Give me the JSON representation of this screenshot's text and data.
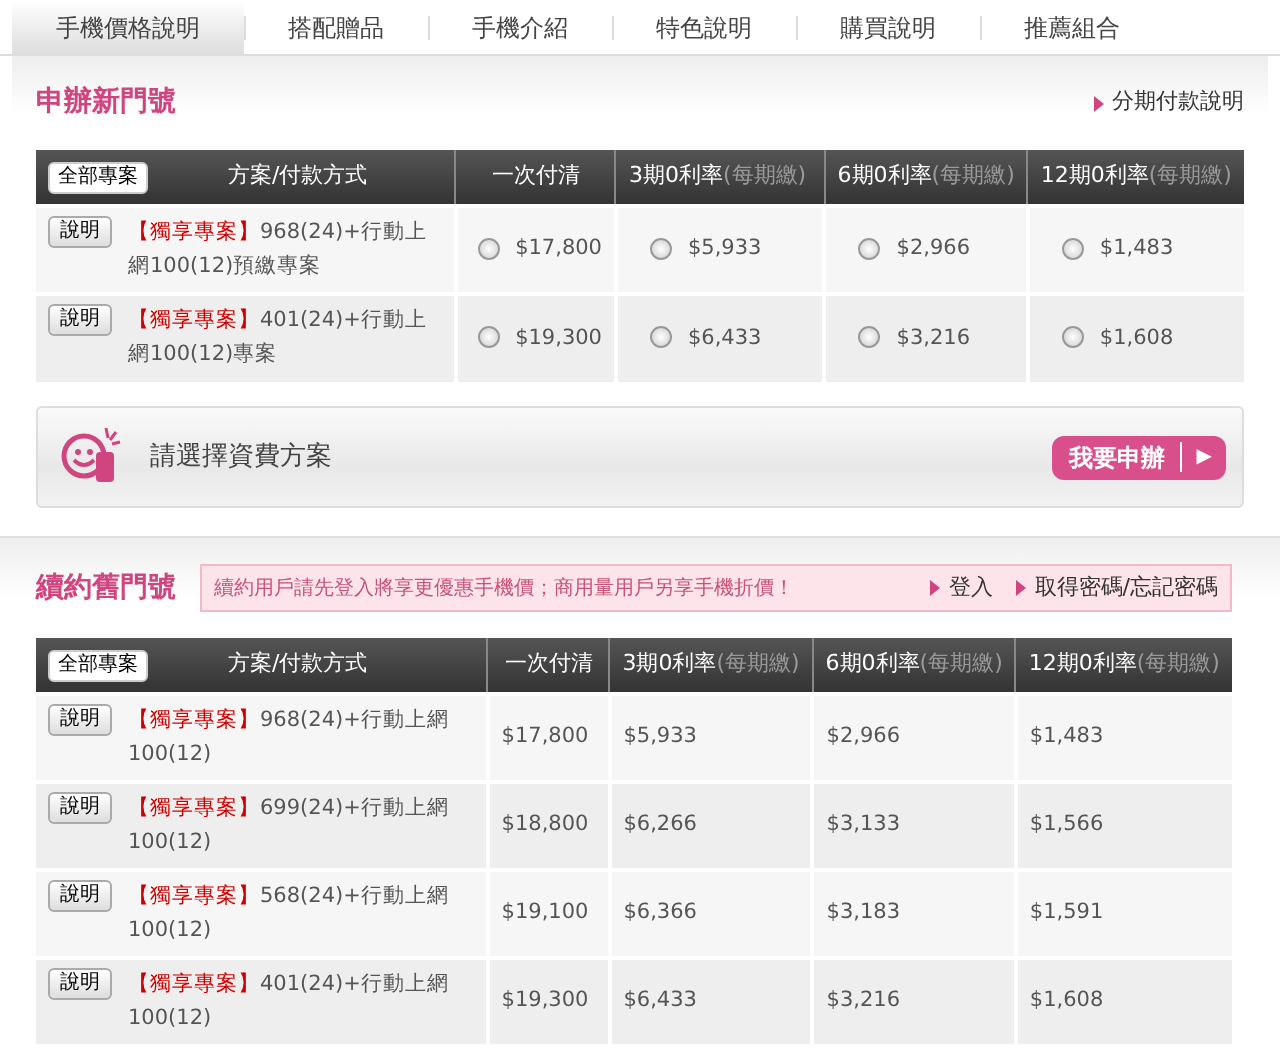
{
  "tabs": [
    {
      "label": "手機價格說明",
      "selected": true
    },
    {
      "label": "搭配贈品",
      "selected": false
    },
    {
      "label": "手機介紹",
      "selected": false
    },
    {
      "label": "特色說明",
      "selected": false
    },
    {
      "label": "購買說明",
      "selected": false
    },
    {
      "label": "推薦組合",
      "selected": false
    }
  ],
  "new_number": {
    "title": "申辦新門號",
    "link": "分期付款說明",
    "table": {
      "filter_button": "全部專案",
      "columns": [
        {
          "label": "方案/付款方式"
        },
        {
          "label": "一次付清"
        },
        {
          "label": "3期0利率",
          "note": "(每期繳)"
        },
        {
          "label": "6期0利率",
          "note": "(每期繳)"
        },
        {
          "label": "12期0利率",
          "note": "(每期繳)"
        }
      ],
      "rows": [
        {
          "info_button": "說明",
          "tag": "【獨享專案】",
          "plan": "968(24)+行動上網100(12)預繳專案",
          "prices": [
            {
              "price": "$17,800",
              "selected": false
            },
            {
              "price": "$5,933",
              "selected": false
            },
            {
              "price": "$2,966",
              "selected": false
            },
            {
              "price": "$1,483",
              "selected": false
            }
          ]
        },
        {
          "info_button": "說明",
          "tag": "【獨享專案】",
          "plan": "401(24)+行動上網100(12)專案",
          "prices": [
            {
              "price": "$19,300",
              "selected": false
            },
            {
              "price": "$6,433",
              "selected": false
            },
            {
              "price": "$3,216",
              "selected": false
            },
            {
              "price": "$1,608",
              "selected": false
            }
          ]
        }
      ]
    },
    "prompt": "請選擇資費方案",
    "apply_button": "我要申辦",
    "apply_arrow": "▶"
  },
  "renewal": {
    "title": "續約舊門號",
    "notice": "續約用戶請先登入將享更優惠手機價；商用量用戶另享手機折價！",
    "links": [
      "登入",
      "取得密碼/忘記密碼"
    ],
    "table": {
      "filter_button": "全部專案",
      "columns": [
        {
          "label": "方案/付款方式"
        },
        {
          "label": "一次付清"
        },
        {
          "label": "3期0利率",
          "note": "(每期繳)"
        },
        {
          "label": "6期0利率",
          "note": "(每期繳)"
        },
        {
          "label": "12期0利率",
          "note": "(每期繳)"
        }
      ],
      "rows": [
        {
          "info_button": "說明",
          "tag": "【獨享專案】",
          "plan": "968(24)+行動上網100(12)",
          "prices": [
            "$17,800",
            "$5,933",
            "$2,966",
            "$1,483"
          ]
        },
        {
          "info_button": "說明",
          "tag": "【獨享專案】",
          "plan": "699(24)+行動上網100(12)",
          "prices": [
            "$18,800",
            "$6,266",
            "$3,133",
            "$1,566"
          ]
        },
        {
          "info_button": "說明",
          "tag": "【獨享專案】",
          "plan": "568(24)+行動上網100(12)",
          "prices": [
            "$19,100",
            "$6,366",
            "$3,183",
            "$1,591"
          ]
        },
        {
          "info_button": "說明",
          "tag": "【獨享專案】",
          "plan": "401(24)+行動上網100(12)",
          "prices": [
            "$19,300",
            "$6,433",
            "$3,216",
            "$1,608"
          ]
        }
      ]
    }
  }
}
